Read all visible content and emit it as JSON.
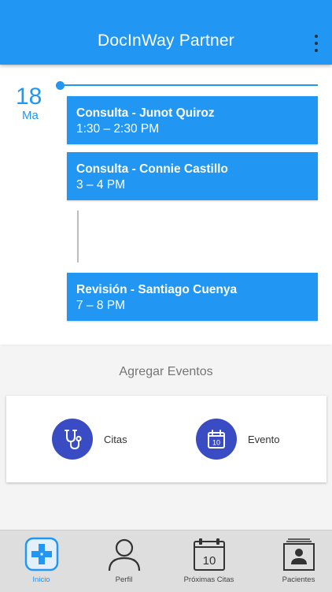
{
  "appbar": {
    "title": "DocInWay Partner"
  },
  "date": {
    "day": "18",
    "weekday": "Ma"
  },
  "events": [
    {
      "title": "Consulta - Junot Quiroz",
      "time": "1:30 – 2:30 PM"
    },
    {
      "title": "Consulta - Connie Castillo",
      "time": "3 – 4 PM"
    },
    {
      "title": "Revisión - Santiago Cuenya",
      "time": "7 – 8 PM"
    }
  ],
  "add_events": {
    "title": "Agregar Eventos",
    "actions": [
      {
        "label": "Citas",
        "icon": "stethoscope-icon"
      },
      {
        "label": "Evento",
        "icon": "calendar-icon"
      }
    ]
  },
  "bottom_nav": {
    "items": [
      {
        "label": "Inicio",
        "icon": "medical-cross-icon",
        "active": true
      },
      {
        "label": "Perfil",
        "icon": "person-icon"
      },
      {
        "label": "Próximas Citas",
        "icon": "calendar-icon",
        "calendar_number": "10"
      },
      {
        "label": "Pacientes",
        "icon": "patients-icon"
      }
    ]
  },
  "calendar_badge": "10",
  "colors": {
    "primary": "#2196f3",
    "action_circle": "#3a4cc4",
    "nav_bg": "#dedede"
  }
}
